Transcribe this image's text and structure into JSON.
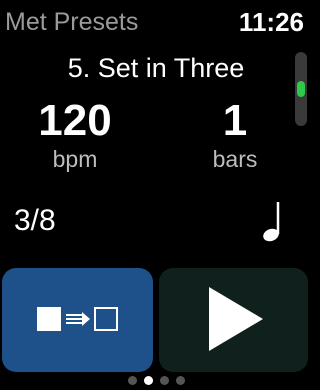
{
  "header": {
    "app_title": "Met Presets",
    "time": "11:26"
  },
  "preset": {
    "name": "5. Set in Three"
  },
  "tempo": {
    "value": "120",
    "unit": "bpm"
  },
  "bars": {
    "value": "1",
    "unit": "bars"
  },
  "time_signature": "3/8",
  "icons": {
    "note": "quarter-note-icon",
    "mode": "square-to-square-icon",
    "play": "play-icon"
  },
  "crown_scroll": {
    "position_fraction": 0.5
  },
  "page_indicator": {
    "count": 4,
    "active_index": 1
  },
  "colors": {
    "mode_button": "#1e5089",
    "play_button": "#10201d",
    "scroll_accent": "#2ec84a"
  }
}
